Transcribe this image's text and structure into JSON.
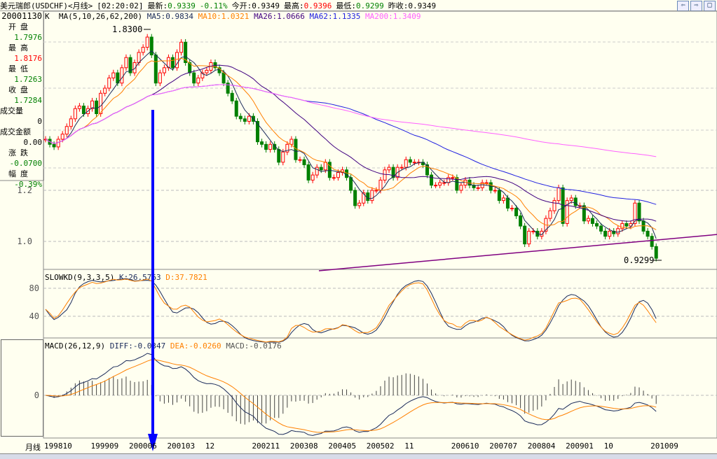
{
  "header": {
    "name": "美元瑞郎(USDCHF)<月线>",
    "time": "[02:20:02]",
    "latest_label": "最新:",
    "latest": "0.9339",
    "change": "-0.11%",
    "open_label": "今开:",
    "open": "0.9349",
    "high_label": "最高:",
    "high": "0.9396",
    "low_label": "最低:",
    "low": "0.9299",
    "prev_label": "昨收:",
    "prev": "0.9349"
  },
  "ma_legend": {
    "k": "K",
    "params": "MA(5,10,26,62,200)",
    "ma5": "MA5:0.9834",
    "ma10": "MA10:1.0321",
    "ma26": "MA26:1.0666",
    "ma62": "MA62:1.1335",
    "ma200": "MA200:1.3409"
  },
  "info": {
    "date": "20001130",
    "open_label": "开盘",
    "open": "1.7976",
    "high_label": "最高",
    "high": "1.8176",
    "low_label": "最低",
    "low": "1.7263",
    "close_label": "收盘",
    "close": "1.7284",
    "vol_label": "成交量",
    "vol": "0",
    "amount_label": "成交金额",
    "amount": "0.00",
    "chg_label": "涨跌",
    "chg": "-0.0700",
    "pct_label": "幅度",
    "pct": "-0.39%"
  },
  "kd_legend": {
    "name": "SLOWKD(9,3,3,5)",
    "k": "K:26.5763",
    "d": "D:37.7821"
  },
  "macd_legend": {
    "name": "MACD(26,12,9)",
    "diff": "DIFF:-0.0347",
    "dea": "DEA:-0.0260",
    "macd": "MACD:-0.0176"
  },
  "colors": {
    "up": "#ff0000",
    "down": "#008000",
    "ma5": "#1a2a5a",
    "ma10": "#ff8000",
    "ma26": "#400080",
    "ma62": "#2020e0",
    "ma200": "#ff60ff",
    "trend": "#800080",
    "arrow": "#0000ff"
  },
  "chart_data": [
    {
      "type": "candlestick",
      "title": "美元瑞郎(USDCHF)<月线>",
      "start": "199810",
      "interval": "month",
      "close": [
        1.4,
        1.38,
        1.37,
        1.4,
        1.42,
        1.45,
        1.48,
        1.52,
        1.53,
        1.5,
        1.52,
        1.55,
        1.5,
        1.58,
        1.6,
        1.64,
        1.66,
        1.62,
        1.68,
        1.72,
        1.66,
        1.7,
        1.74,
        1.76,
        1.8,
        1.73,
        1.62,
        1.66,
        1.68,
        1.72,
        1.68,
        1.74,
        1.78,
        1.7,
        1.66,
        1.62,
        1.64,
        1.66,
        1.67,
        1.7,
        1.68,
        1.66,
        1.62,
        1.58,
        1.55,
        1.49,
        1.48,
        1.47,
        1.49,
        1.47,
        1.39,
        1.38,
        1.36,
        1.38,
        1.36,
        1.31,
        1.35,
        1.38,
        1.4,
        1.32,
        1.32,
        1.3,
        1.24,
        1.26,
        1.29,
        1.28,
        1.31,
        1.25,
        1.25,
        1.27,
        1.28,
        1.25,
        1.2,
        1.14,
        1.15,
        1.19,
        1.16,
        1.2,
        1.2,
        1.24,
        1.28,
        1.29,
        1.25,
        1.29,
        1.29,
        1.32,
        1.31,
        1.31,
        1.31,
        1.3,
        1.26,
        1.22,
        1.22,
        1.23,
        1.23,
        1.25,
        1.25,
        1.2,
        1.22,
        1.24,
        1.22,
        1.21,
        1.21,
        1.23,
        1.23,
        1.2,
        1.2,
        1.16,
        1.17,
        1.13,
        1.13,
        1.1,
        1.06,
        0.99,
        1.04,
        1.04,
        1.02,
        1.04,
        1.09,
        1.12,
        1.16,
        1.21,
        1.07,
        1.16,
        1.17,
        1.14,
        1.14,
        1.08,
        1.09,
        1.07,
        1.06,
        1.04,
        1.02,
        1.04,
        1.03,
        1.05,
        1.07,
        1.06,
        1.07,
        1.15,
        1.08,
        1.04,
        1.02,
        0.98,
        0.9339
      ],
      "y_ticks": [
        "1.2",
        "1.0"
      ],
      "y_tick_values": [
        1.2,
        1.0
      ],
      "annotations": {
        "max": "1.8300",
        "min": "0.9299"
      },
      "trendline": {
        "from": [
          "200405",
          0.885
        ],
        "to": [
          "201010+",
          1.027
        ]
      },
      "x_ticks": [
        "199810",
        "199909",
        "200006",
        "200103",
        "12",
        "200211",
        "200308",
        "200405",
        "200502",
        "11",
        "200610",
        "200707",
        "200804",
        "200901",
        "10",
        "201009"
      ],
      "x_tick_months": [
        "199810",
        "199909",
        "200006",
        "200103",
        "200112",
        "200211",
        "200308",
        "200405",
        "200502",
        "200511",
        "200610",
        "200707",
        "200804",
        "200901",
        "200910",
        "201009"
      ],
      "x_axis_label": "月线"
    },
    {
      "type": "line",
      "name": "SLOWKD",
      "y_ticks": [
        "80",
        "40"
      ],
      "y_tick_values": [
        80,
        40
      ]
    },
    {
      "type": "bar+line",
      "name": "MACD",
      "y_ticks": [
        "0"
      ],
      "y_tick_values": [
        0
      ]
    }
  ]
}
